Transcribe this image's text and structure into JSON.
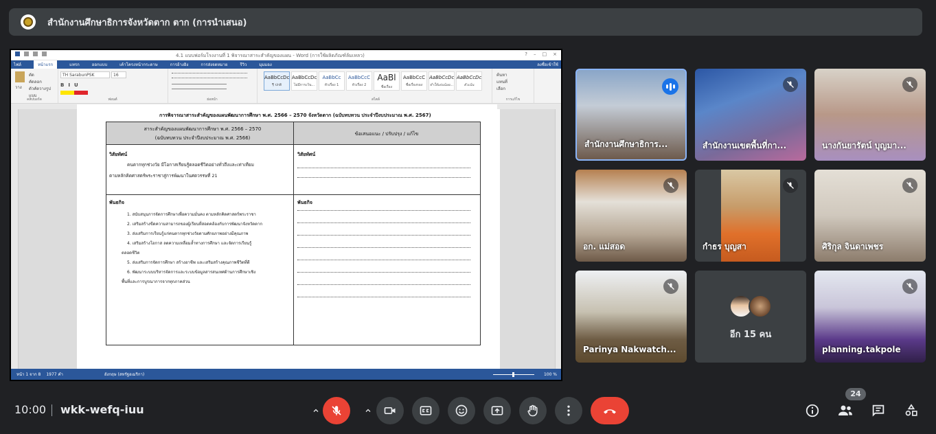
{
  "meeting": {
    "title": "สำนักงานศึกษาธิการจังหวัดตาก ตาก (การนำเสนอ)",
    "time": "10:00",
    "code": "wkk-wefq-iuu",
    "participant_count": "24"
  },
  "word": {
    "window_title": "4.1 แบบฟอร์มโรงงานที่ 1 พิจารณาสาระสำคัญของแผน - Word (การใช้ผลิตภัณฑ์ล้มเหลว)",
    "tabs": [
      "ไฟล์",
      "หน้าแรก",
      "แทรก",
      "ออกแบบ",
      "เค้าโครงหน้ากระดาษ",
      "การอ้างอิง",
      "การส่งจดหมาย",
      "รีวิว",
      "มุมมอง"
    ],
    "user_label": "ลงชื่อเข้าใช้",
    "font_name": "TH SarabunPSK",
    "font_size": "16",
    "clipboard_items": [
      "ตัด",
      "คัดลอก",
      "ตัวคัดวางรูปแบบ"
    ],
    "paste_label": "วาง",
    "group_labels": [
      "คลิปบอร์ด",
      "ฟอนต์",
      "ย่อหน้า",
      "สไตล์",
      "การแก้ไข"
    ],
    "editing_items": [
      "ค้นหา",
      "แทนที่",
      "เลือก"
    ],
    "styles": [
      {
        "preview": "AaBbCcDc",
        "name": "¶ ปกติ"
      },
      {
        "preview": "AaBbCcDc",
        "name": "ไม่มีการเว้น..."
      },
      {
        "preview": "AaBbCc",
        "name": "หัวเรื่อง 1"
      },
      {
        "preview": "AaBbCcC",
        "name": "หัวเรื่อง 2"
      },
      {
        "preview": "AaBl",
        "name": "ชื่อเรื่อง"
      },
      {
        "preview": "AaBbCcC",
        "name": "ชื่อเรื่องรอง"
      },
      {
        "preview": "AaBbCcDc",
        "name": "ทำให้เด่นน้อย..."
      },
      {
        "preview": "AaBbCcDc",
        "name": "ตัวเน้น"
      }
    ],
    "doc": {
      "heading": "การพิจารณาสาระสำคัญของแผนพัฒนาการศึกษา พ.ศ. 2566 – 2570 จังหวัดตาก (ฉบับทบทวน ประจำปีงบประมาณ พ.ศ. 2567)",
      "col1_header_line1": "สาระสำคัญของแผนพัฒนาการศึกษา พ.ศ. 2566 – 2570",
      "col1_header_line2": "(ฉบับทบทวน ประจำปีงบประมาณ พ.ศ. 2566)",
      "col2_header": "ข้อเสนอแนะ / ปรับปรุง / แก้ไข",
      "vision_label": "วิสัยทัศน์",
      "vision_text_line1": "คนตากทุกช่วงวัย มีโอกาสเรียนรู้ตลอดชีวิตอย่างทั่วถึงและเท่าเทียม",
      "vision_text_line2": "ตามหลักคิดศาสตร์พระราชาสู่การพัฒนาในศตวรรษที่ 21",
      "mission_label": "พันธกิจ",
      "missions": [
        "1. สนับสนุนการจัดการศึกษาเพื่อความมั่นคง ตามหลักคิดศาสตร์พระราชา",
        "2. เสริมสร้างขีดความสามารถของผู้เรียนที่สอดคล้องกับการพัฒนาจังหวัดตาก",
        "3. ส่งเสริมการเรียนรู้แก่คนตากทุกช่วงวัยตามศักยภาพอย่างมีคุณภาพ",
        "4. เสริมสร้างโอกาส ลดความเหลื่อมล้ำทางการศึกษา และจัดการเรียนรู้",
        "ตลอดชีวิต",
        "5. ส่งเสริมการจัดการศึกษา สร้างอาชีพ และเสริมสร้างคุณภาพชีวิตที่ดี",
        "6. พัฒนาระบบบริหารจัดการและระบบข้อมูลสารสนเทศด้านการศึกษาเชิง",
        "พื้นที่และการบูรณาการจากทุกภาคส่วน"
      ]
    },
    "status": {
      "page": "หน้า 1 จาก 8",
      "words": "1977 คำ",
      "language": "อังกฤษ (สหรัฐอเมริกา)",
      "zoom": "100 %"
    }
  },
  "participants": [
    {
      "name": "สำนักงานศึกษาธิการ...",
      "speaking": true,
      "muted": false
    },
    {
      "name": "สำนักงานเขตพื้นที่กา...",
      "speaking": false,
      "muted": true
    },
    {
      "name": "นางกันยารัตน์ บุญมา...",
      "speaking": false,
      "muted": true
    },
    {
      "name": "อก. แม่สอด",
      "speaking": false,
      "muted": true
    },
    {
      "name": "กำธร บุญสา",
      "speaking": false,
      "muted": true
    },
    {
      "name": "ศิริกุล จินดาเพชร",
      "speaking": false,
      "muted": true
    },
    {
      "name": "Parinya Nakwatch...",
      "speaking": false,
      "muted": true
    },
    {
      "name": "planning.takpole",
      "speaking": false,
      "muted": true
    }
  ],
  "others_tile": {
    "label": "อีก 15 คน"
  },
  "colors": {
    "background": "#202124",
    "surface": "#3c4043",
    "red": "#ea4335",
    "word_blue": "#2b579a",
    "active_border": "#8ab4f8"
  }
}
